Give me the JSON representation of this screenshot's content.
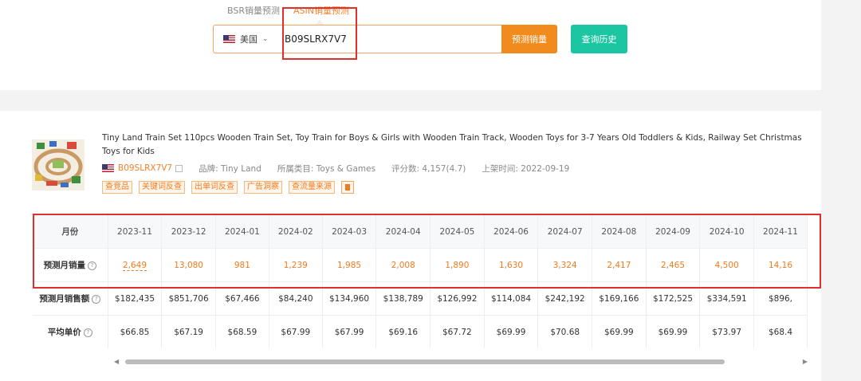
{
  "search": {
    "tabs": [
      "BSR销量预测",
      "ASIN销量预测"
    ],
    "country": "美国",
    "asin_value": "B09SLRX7V7",
    "predict_button": "预测销量",
    "history_button": "查询历史"
  },
  "product": {
    "title": "Tiny Land Train Set 110pcs Wooden Train Set, Toy Train for Boys & Girls with Wooden Train Track, Wooden Toys for 3-7 Years Old Toddlers & Kids, Railway Set Christmas Toys for Kids",
    "asin": "B09SLRX7V7",
    "brand": "品牌: Tiny Land",
    "category": "所属类目: Toys & Games",
    "rating": "评分数: 4,157(4.7)",
    "launch_date": "上架时间: 2022-09-19",
    "tags": [
      "查竞品",
      "关键词反查",
      "出单词反查",
      "广告洞察",
      "查流量来源"
    ]
  },
  "table": {
    "labels": {
      "month": "月份",
      "units": "预测月销量",
      "sales": "预测月销售额",
      "price": "平均单价"
    },
    "months": [
      "2023-11",
      "2023-12",
      "2024-01",
      "2024-02",
      "2024-03",
      "2024-04",
      "2024-05",
      "2024-06",
      "2024-07",
      "2024-08",
      "2024-09",
      "2024-10",
      "2024-11"
    ],
    "units": [
      "2,649",
      "13,080",
      "981",
      "1,239",
      "1,985",
      "2,008",
      "1,890",
      "1,630",
      "3,324",
      "2,417",
      "2,465",
      "4,500",
      "14,16"
    ],
    "sales": [
      "$182,435",
      "$851,706",
      "$67,466",
      "$84,240",
      "$134,960",
      "$138,789",
      "$126,992",
      "$114,084",
      "$242,192",
      "$169,166",
      "$172,525",
      "$334,591",
      "$896,"
    ],
    "price": [
      "$66.85",
      "$67.19",
      "$68.59",
      "$67.99",
      "$67.99",
      "$69.16",
      "$67.72",
      "$69.99",
      "$70.68",
      "$69.99",
      "$69.99",
      "$73.97",
      "$68.4"
    ]
  },
  "colors": {
    "accent_orange": "#f28b1e",
    "teal": "#1dc6a3",
    "highlight_red": "#e0302b"
  }
}
